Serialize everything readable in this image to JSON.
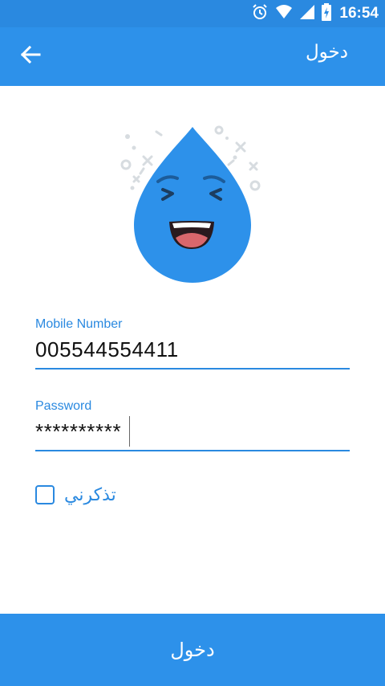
{
  "status_bar": {
    "time": "16:54",
    "icons": [
      "alarm-icon",
      "wifi-icon",
      "signal-icon",
      "battery-charging-icon"
    ]
  },
  "app_bar": {
    "title": "دخول",
    "back_icon": "arrow-left-icon"
  },
  "mascot": {
    "description_icon": "water-drop-mascot-icon",
    "colors": {
      "drop": "#2D91EA",
      "mouth": "#D9676C",
      "decor": "#D7DCE0"
    }
  },
  "form": {
    "mobile": {
      "label": "Mobile Number",
      "value": "005544554411"
    },
    "password": {
      "label": "Password",
      "value": "**********"
    },
    "remember_me": {
      "label": "تذكرني",
      "checked": false
    }
  },
  "login_button": {
    "label": "دخول"
  },
  "colors": {
    "primary": "#2D91EA",
    "status_bar": "#2A89E0",
    "accent_text": "#2A89E0"
  }
}
